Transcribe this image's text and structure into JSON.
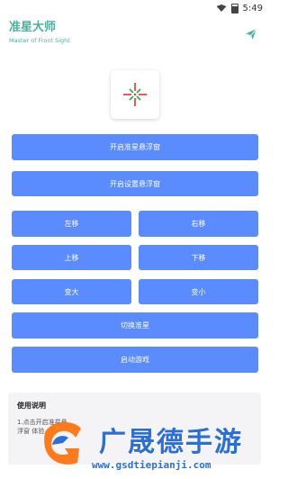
{
  "status_bar": {
    "time": "5:49"
  },
  "app": {
    "title": "准星大师",
    "subtitle": "Master of Front Sight",
    "accent": "#4ab0a0"
  },
  "buttons": {
    "open_crosshair": "开启准星悬浮窗",
    "open_settings": "开启设置悬浮窗",
    "left": "左移",
    "right": "右移",
    "up": "上移",
    "down": "下移",
    "bigger": "变大",
    "smaller": "变小",
    "switch": "切换准星",
    "start_game": "启动游戏",
    "color": "#5b8cff"
  },
  "usage": {
    "title": "使用说明",
    "text": "1.点击开启准星悬浮窗 体验"
  },
  "watermark": {
    "brand": "广晟德手游",
    "url": "www.gsdtiepianji.com"
  },
  "icons": [
    "wifi-icon",
    "battery-icon",
    "send-icon",
    "crosshair-icon"
  ]
}
